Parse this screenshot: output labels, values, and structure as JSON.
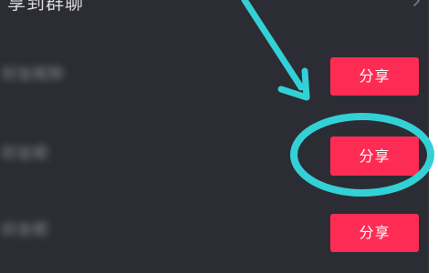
{
  "header": {
    "title": "享到群聊",
    "chevron_icon": "chevron-right-icon"
  },
  "rows": [
    {
      "name": "好友昵称",
      "share_label": "分享"
    },
    {
      "name": "好友昵",
      "share_label": "分享"
    },
    {
      "name": "好友昵",
      "share_label": "分享"
    }
  ],
  "annotation": {
    "arrow_icon": "arrow-icon",
    "highlight_shape": "ellipse-highlight",
    "color": "#33d1d6"
  },
  "colors": {
    "panel_background": "#2c2d34",
    "share_button": "#fe2c55",
    "button_text": "#ffffff"
  }
}
